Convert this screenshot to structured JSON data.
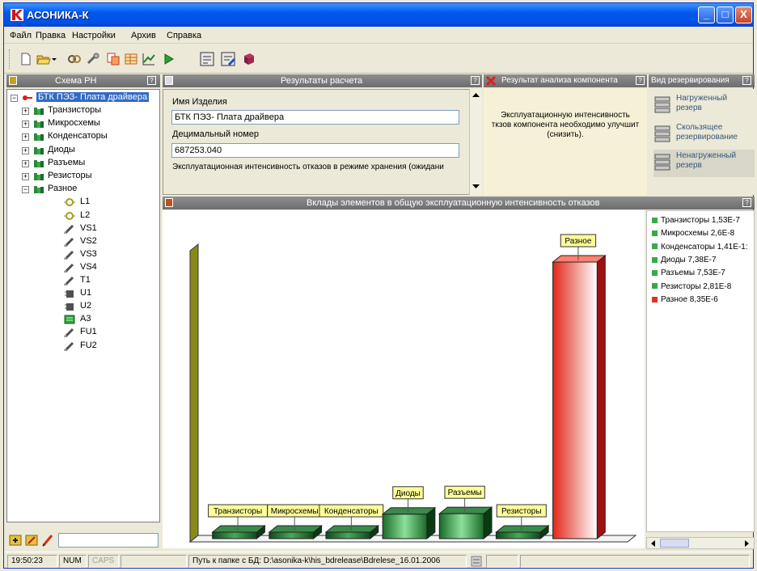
{
  "window": {
    "title": "АСОНИКА-К",
    "controls": [
      "_",
      "□",
      "X"
    ]
  },
  "menu": [
    "Файл",
    "Правка",
    "Настройки",
    "Архив",
    "Справка"
  ],
  "toolbar_icons": [
    "new-file-icon",
    "open-folder-icon",
    "dropdown-arrow-icon",
    "link-icon",
    "tools-icon",
    "copy-icon",
    "table-icon",
    "chart-icon",
    "play-icon",
    "report-icon",
    "report-edit-icon",
    "book-icon"
  ],
  "tree_panel": {
    "title": "Схема РН",
    "help": "?",
    "root": "БТК ПЭЗ- Плата драйвера",
    "groups": [
      "Транзисторы",
      "Микросхемы",
      "Конденсаторы",
      "Диоды",
      "Разъемы",
      "Резисторы",
      "Разное"
    ],
    "leaves": [
      "L1",
      "L2",
      "VS1",
      "VS2",
      "VS3",
      "VS4",
      "T1",
      "U1",
      "U2",
      "A3",
      "FU1",
      "FU2"
    ]
  },
  "results_panel": {
    "title": "Результаты расчета",
    "help": "?",
    "name_label": "Имя Изделия",
    "name_value": "БТК ПЭЗ- Плата драйвера",
    "decimal_label": "Децимальный номер",
    "decimal_value": "687253.040",
    "storage_label": "Эксплуатационная интенсивность отказов в режиме хранения (ожидани"
  },
  "analysis_panel": {
    "title": "Результат анализа компонента",
    "help": "?",
    "text_line1": "Эксплуатационную интенсивность",
    "text_line2": "ткзов компонента необходимо улучшит",
    "text_line3": "(снизить)."
  },
  "reservation_panel": {
    "title": "Вид резервирования",
    "help": "?",
    "items": [
      {
        "line1": "Нагруженный",
        "line2": "резерв"
      },
      {
        "line1": "Скользящее",
        "line2": "резервирование"
      },
      {
        "line1": "Ненагруженный",
        "line2": "резерв"
      }
    ]
  },
  "chart_panel": {
    "title": "Вклады элементов в общую эксплуатационную интенсивность отказов",
    "help": "?"
  },
  "chart_data": {
    "type": "bar",
    "categories": [
      "Транзисторы",
      "Микросхемы",
      "Конденсаторы",
      "Диоды",
      "Разъемы",
      "Резисторы",
      "Разное"
    ],
    "values": [
      1.53e-07,
      2.6e-08,
      1.41e-08,
      7.38e-07,
      7.53e-07,
      2.81e-08,
      8.35e-06
    ],
    "colors": [
      "#1f7a3a",
      "#1f7a3a",
      "#1f7a3a",
      "#2faa4a",
      "#2faa4a",
      "#1f7a3a",
      "#e03020"
    ],
    "title": "Вклады элементов в общую эксплуатационную интенсивность отказов",
    "legend_position": "right",
    "legend": [
      {
        "label": "Транзисторы 1,53E-7",
        "color": "#3aa84a"
      },
      {
        "label": "Микросхемы 2,6E-8",
        "color": "#3aa84a"
      },
      {
        "label": "Конденсаторы 1,41E-1:",
        "color": "#3aa84a"
      },
      {
        "label": "Диоды 7,38E-7",
        "color": "#3aa84a"
      },
      {
        "label": "Разъемы 7,53E-7",
        "color": "#3aa84a"
      },
      {
        "label": "Резисторы 2,81E-8",
        "color": "#3aa84a"
      },
      {
        "label": "Разное 8,35E-6",
        "color": "#e03020"
      }
    ]
  },
  "statusbar": {
    "time": "19:50:23",
    "num": "NUM",
    "caps": "CAPS",
    "path": "Путь к папке с БД: D:\\asonika-k\\his_bdrelease\\Bdrelese_16.01.2006"
  }
}
